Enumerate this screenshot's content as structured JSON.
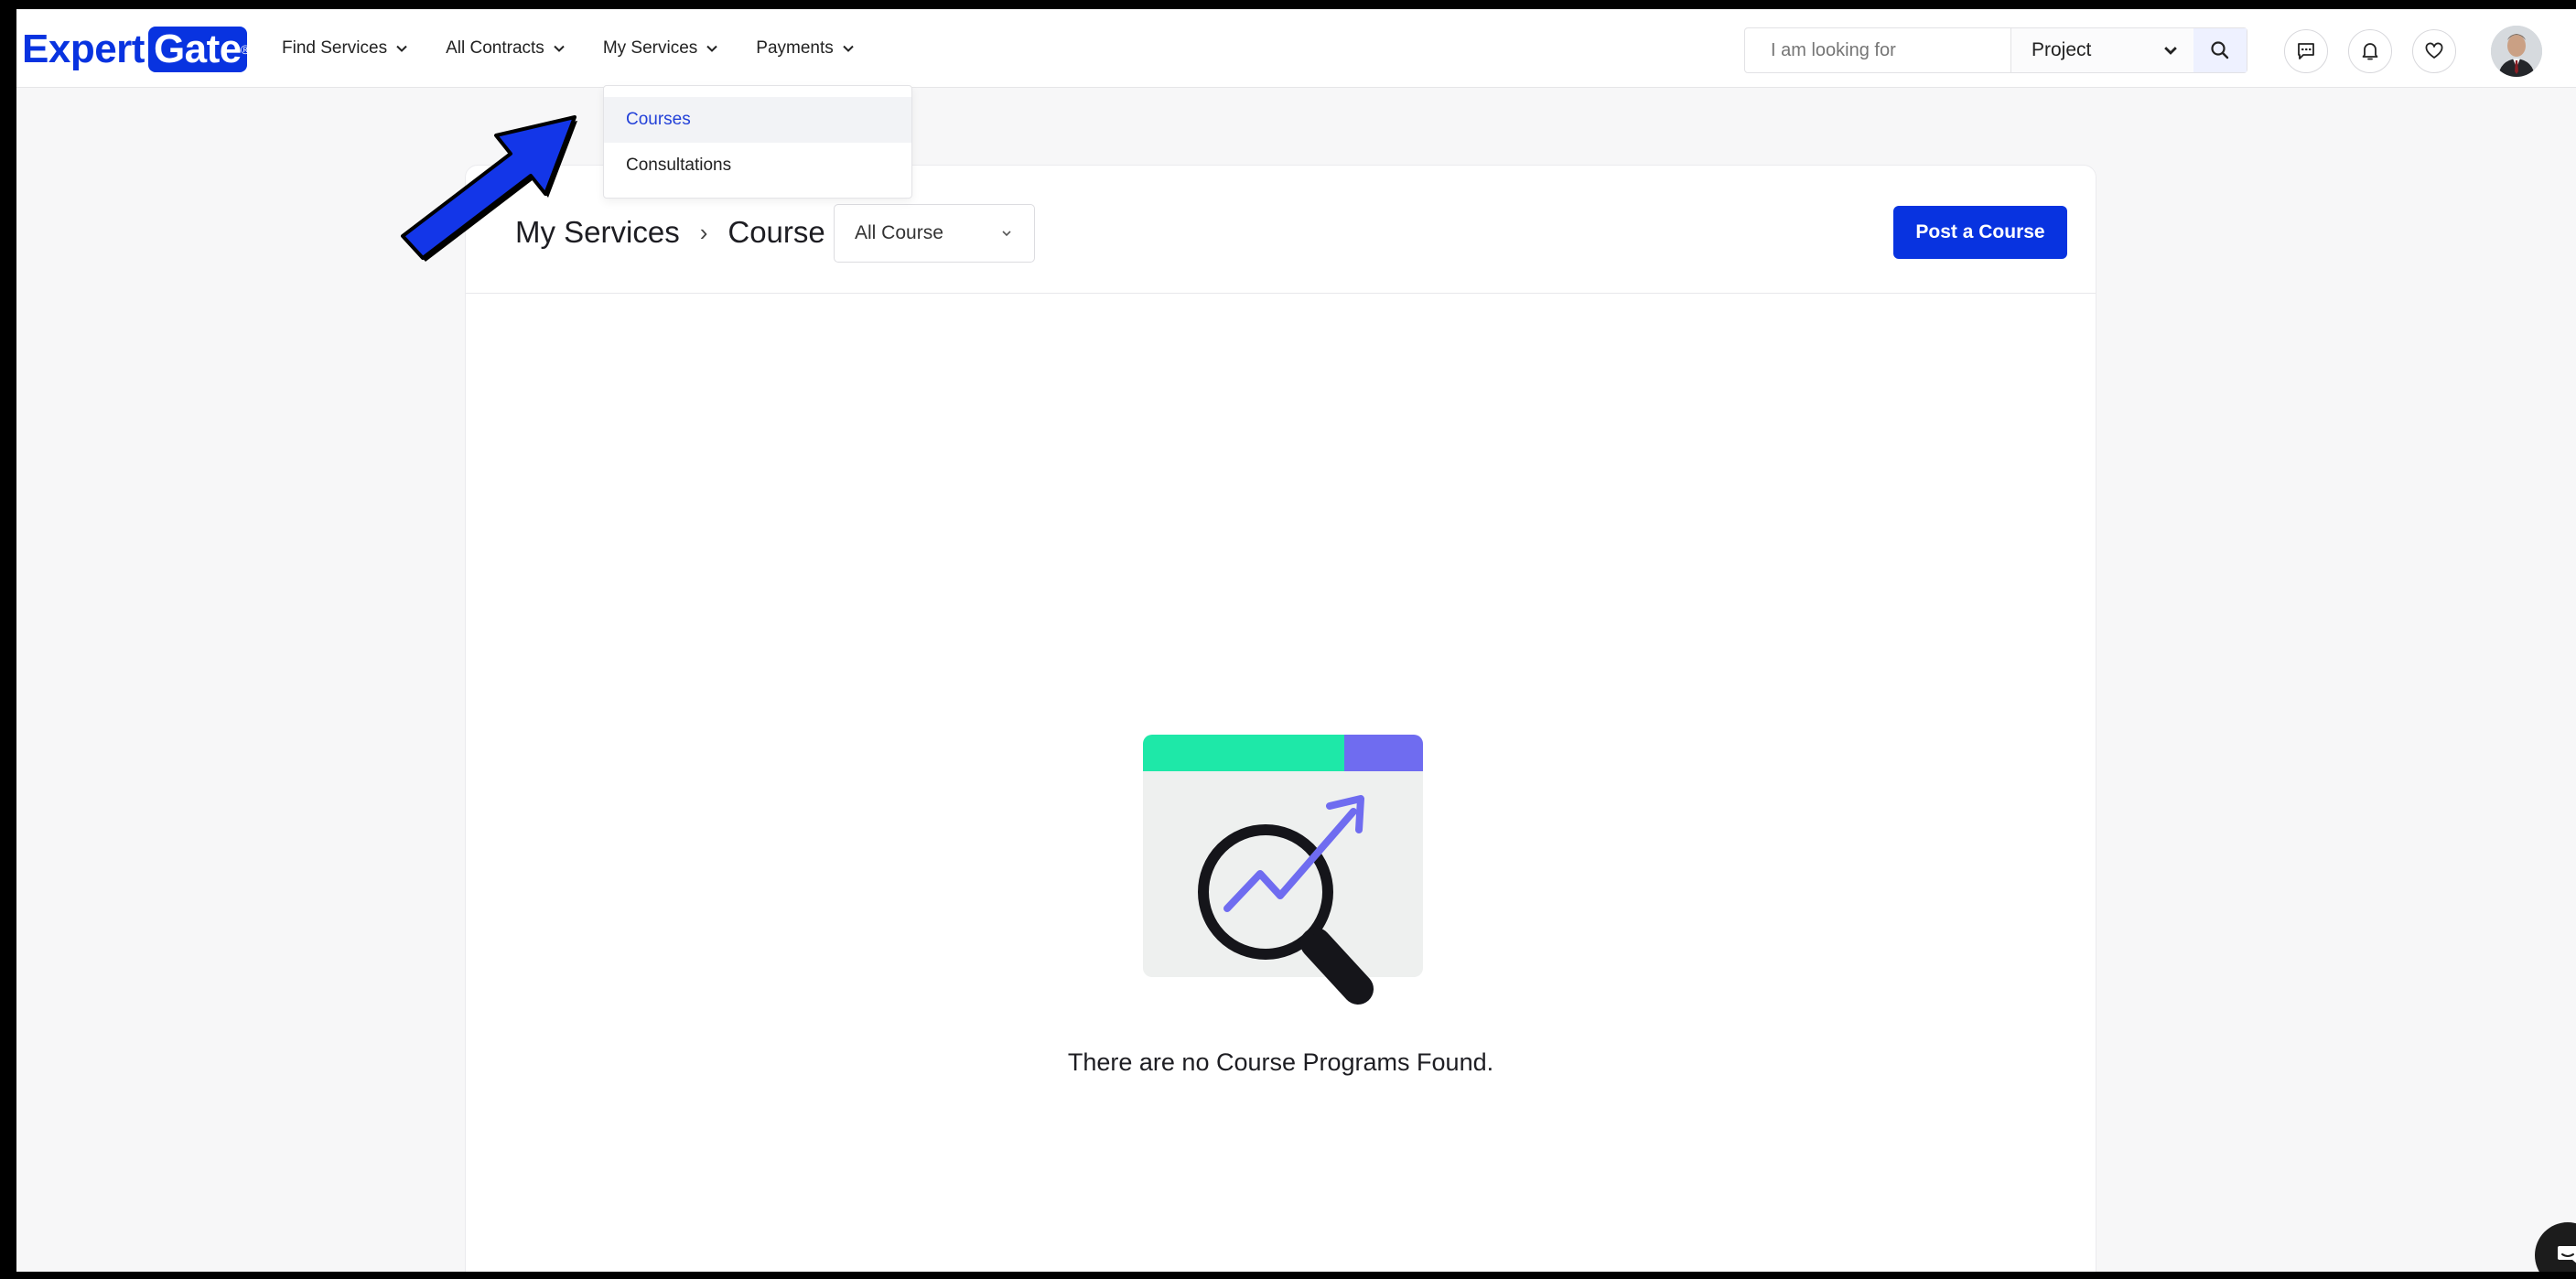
{
  "header": {
    "logo_part1": "Expert",
    "logo_part2": "Gate",
    "logo_mark": "®",
    "nav": [
      {
        "label": "Find Services"
      },
      {
        "label": "All Contracts"
      },
      {
        "label": "My Services"
      },
      {
        "label": "Payments"
      }
    ],
    "search": {
      "placeholder": "I am looking for",
      "type_value": "Project"
    },
    "icons": [
      "message-icon",
      "bell-icon",
      "heart-icon"
    ]
  },
  "dropdown": {
    "items": [
      {
        "label": "Courses",
        "active": true
      },
      {
        "label": "Consultations",
        "active": false
      }
    ]
  },
  "main": {
    "breadcrumb": {
      "section": "My Services",
      "separator": "›",
      "page": "Course"
    },
    "filter_value": "All Course",
    "post_button": "Post a Course",
    "empty_message": "There are no Course Programs Found."
  },
  "colors": {
    "brand": "#0833e0",
    "illus_green": "#1ee8a8",
    "illus_purple": "#6f6cf0",
    "annotation_arrow": "#1336e8"
  }
}
